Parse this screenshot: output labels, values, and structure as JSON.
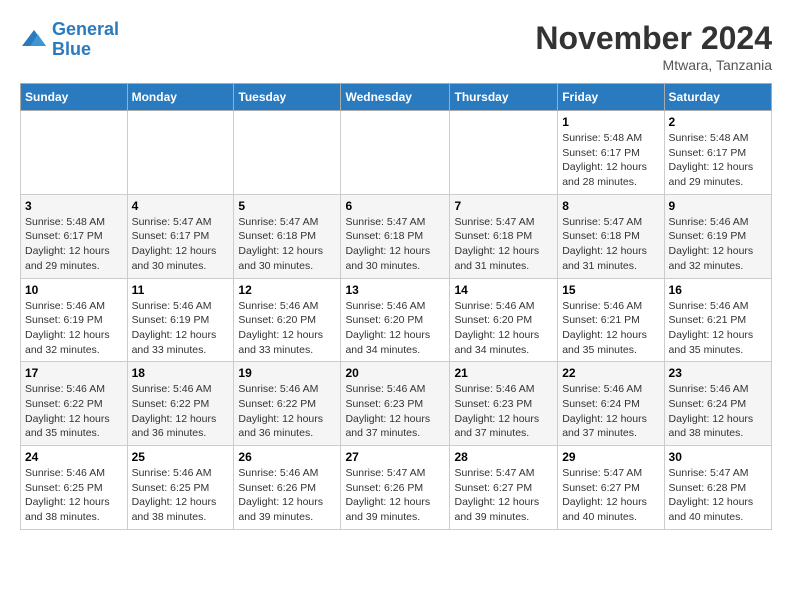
{
  "header": {
    "logo_line1": "General",
    "logo_line2": "Blue",
    "month": "November 2024",
    "location": "Mtwara, Tanzania"
  },
  "weekdays": [
    "Sunday",
    "Monday",
    "Tuesday",
    "Wednesday",
    "Thursday",
    "Friday",
    "Saturday"
  ],
  "weeks": [
    [
      {
        "day": "",
        "info": ""
      },
      {
        "day": "",
        "info": ""
      },
      {
        "day": "",
        "info": ""
      },
      {
        "day": "",
        "info": ""
      },
      {
        "day": "",
        "info": ""
      },
      {
        "day": "1",
        "info": "Sunrise: 5:48 AM\nSunset: 6:17 PM\nDaylight: 12 hours and 28 minutes."
      },
      {
        "day": "2",
        "info": "Sunrise: 5:48 AM\nSunset: 6:17 PM\nDaylight: 12 hours and 29 minutes."
      }
    ],
    [
      {
        "day": "3",
        "info": "Sunrise: 5:48 AM\nSunset: 6:17 PM\nDaylight: 12 hours and 29 minutes."
      },
      {
        "day": "4",
        "info": "Sunrise: 5:47 AM\nSunset: 6:17 PM\nDaylight: 12 hours and 30 minutes."
      },
      {
        "day": "5",
        "info": "Sunrise: 5:47 AM\nSunset: 6:18 PM\nDaylight: 12 hours and 30 minutes."
      },
      {
        "day": "6",
        "info": "Sunrise: 5:47 AM\nSunset: 6:18 PM\nDaylight: 12 hours and 30 minutes."
      },
      {
        "day": "7",
        "info": "Sunrise: 5:47 AM\nSunset: 6:18 PM\nDaylight: 12 hours and 31 minutes."
      },
      {
        "day": "8",
        "info": "Sunrise: 5:47 AM\nSunset: 6:18 PM\nDaylight: 12 hours and 31 minutes."
      },
      {
        "day": "9",
        "info": "Sunrise: 5:46 AM\nSunset: 6:19 PM\nDaylight: 12 hours and 32 minutes."
      }
    ],
    [
      {
        "day": "10",
        "info": "Sunrise: 5:46 AM\nSunset: 6:19 PM\nDaylight: 12 hours and 32 minutes."
      },
      {
        "day": "11",
        "info": "Sunrise: 5:46 AM\nSunset: 6:19 PM\nDaylight: 12 hours and 33 minutes."
      },
      {
        "day": "12",
        "info": "Sunrise: 5:46 AM\nSunset: 6:20 PM\nDaylight: 12 hours and 33 minutes."
      },
      {
        "day": "13",
        "info": "Sunrise: 5:46 AM\nSunset: 6:20 PM\nDaylight: 12 hours and 34 minutes."
      },
      {
        "day": "14",
        "info": "Sunrise: 5:46 AM\nSunset: 6:20 PM\nDaylight: 12 hours and 34 minutes."
      },
      {
        "day": "15",
        "info": "Sunrise: 5:46 AM\nSunset: 6:21 PM\nDaylight: 12 hours and 35 minutes."
      },
      {
        "day": "16",
        "info": "Sunrise: 5:46 AM\nSunset: 6:21 PM\nDaylight: 12 hours and 35 minutes."
      }
    ],
    [
      {
        "day": "17",
        "info": "Sunrise: 5:46 AM\nSunset: 6:22 PM\nDaylight: 12 hours and 35 minutes."
      },
      {
        "day": "18",
        "info": "Sunrise: 5:46 AM\nSunset: 6:22 PM\nDaylight: 12 hours and 36 minutes."
      },
      {
        "day": "19",
        "info": "Sunrise: 5:46 AM\nSunset: 6:22 PM\nDaylight: 12 hours and 36 minutes."
      },
      {
        "day": "20",
        "info": "Sunrise: 5:46 AM\nSunset: 6:23 PM\nDaylight: 12 hours and 37 minutes."
      },
      {
        "day": "21",
        "info": "Sunrise: 5:46 AM\nSunset: 6:23 PM\nDaylight: 12 hours and 37 minutes."
      },
      {
        "day": "22",
        "info": "Sunrise: 5:46 AM\nSunset: 6:24 PM\nDaylight: 12 hours and 37 minutes."
      },
      {
        "day": "23",
        "info": "Sunrise: 5:46 AM\nSunset: 6:24 PM\nDaylight: 12 hours and 38 minutes."
      }
    ],
    [
      {
        "day": "24",
        "info": "Sunrise: 5:46 AM\nSunset: 6:25 PM\nDaylight: 12 hours and 38 minutes."
      },
      {
        "day": "25",
        "info": "Sunrise: 5:46 AM\nSunset: 6:25 PM\nDaylight: 12 hours and 38 minutes."
      },
      {
        "day": "26",
        "info": "Sunrise: 5:46 AM\nSunset: 6:26 PM\nDaylight: 12 hours and 39 minutes."
      },
      {
        "day": "27",
        "info": "Sunrise: 5:47 AM\nSunset: 6:26 PM\nDaylight: 12 hours and 39 minutes."
      },
      {
        "day": "28",
        "info": "Sunrise: 5:47 AM\nSunset: 6:27 PM\nDaylight: 12 hours and 39 minutes."
      },
      {
        "day": "29",
        "info": "Sunrise: 5:47 AM\nSunset: 6:27 PM\nDaylight: 12 hours and 40 minutes."
      },
      {
        "day": "30",
        "info": "Sunrise: 5:47 AM\nSunset: 6:28 PM\nDaylight: 12 hours and 40 minutes."
      }
    ]
  ]
}
